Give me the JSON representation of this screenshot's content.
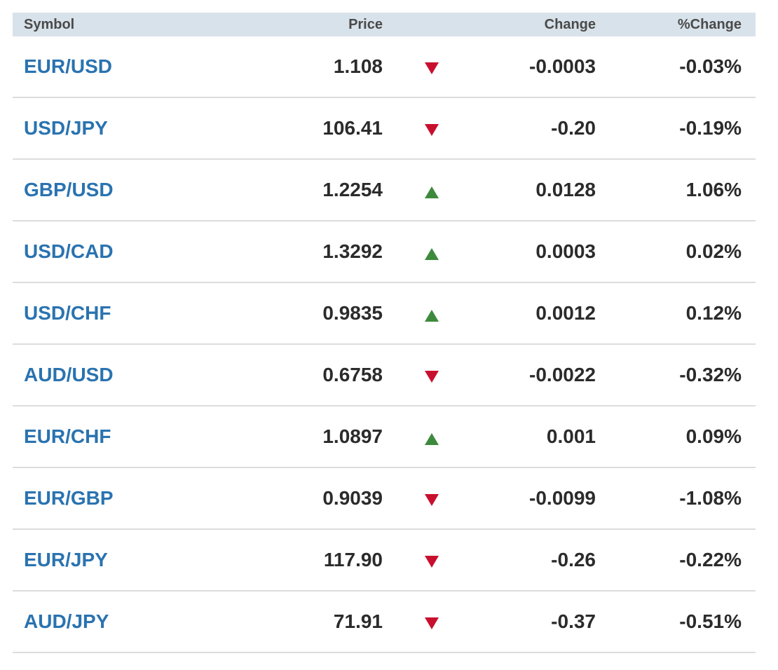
{
  "table": {
    "headers": {
      "symbol": "Symbol",
      "price": "Price",
      "change": "Change",
      "pct_change": "%Change"
    },
    "colors": {
      "link": "#2a73b0",
      "up": "#3d8a3d",
      "down": "#c8102e",
      "header_bg": "#d8e2ea"
    },
    "rows": [
      {
        "symbol": "EUR/USD",
        "price": "1.108",
        "direction": "down-arrow-icon",
        "change": "-0.0003",
        "pct_change": "-0.03%"
      },
      {
        "symbol": "USD/JPY",
        "price": "106.41",
        "direction": "down-arrow-icon",
        "change": "-0.20",
        "pct_change": "-0.19%"
      },
      {
        "symbol": "GBP/USD",
        "price": "1.2254",
        "direction": "up-arrow-icon",
        "change": "0.0128",
        "pct_change": "1.06%"
      },
      {
        "symbol": "USD/CAD",
        "price": "1.3292",
        "direction": "up-arrow-icon",
        "change": "0.0003",
        "pct_change": "0.02%"
      },
      {
        "symbol": "USD/CHF",
        "price": "0.9835",
        "direction": "up-arrow-icon",
        "change": "0.0012",
        "pct_change": "0.12%"
      },
      {
        "symbol": "AUD/USD",
        "price": "0.6758",
        "direction": "down-arrow-icon",
        "change": "-0.0022",
        "pct_change": "-0.32%"
      },
      {
        "symbol": "EUR/CHF",
        "price": "1.0897",
        "direction": "up-arrow-icon",
        "change": "0.001",
        "pct_change": "0.09%"
      },
      {
        "symbol": "EUR/GBP",
        "price": "0.9039",
        "direction": "down-arrow-icon",
        "change": "-0.0099",
        "pct_change": "-1.08%"
      },
      {
        "symbol": "EUR/JPY",
        "price": "117.90",
        "direction": "down-arrow-icon",
        "change": "-0.26",
        "pct_change": "-0.22%"
      },
      {
        "symbol": "AUD/JPY",
        "price": "71.91",
        "direction": "down-arrow-icon",
        "change": "-0.37",
        "pct_change": "-0.51%"
      }
    ]
  }
}
